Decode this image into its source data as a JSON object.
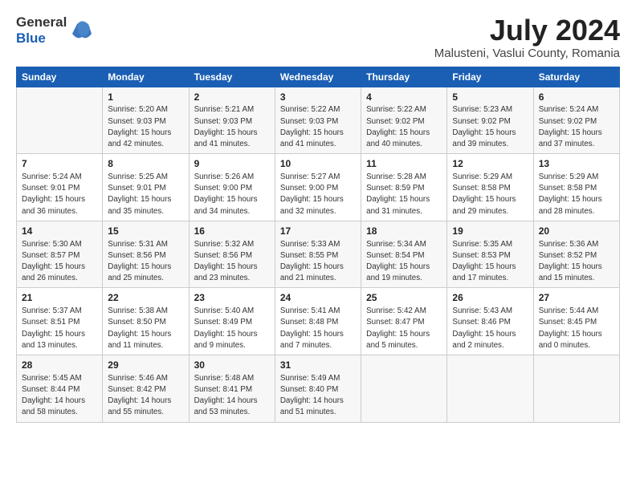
{
  "logo": {
    "line1": "General",
    "line2": "Blue"
  },
  "title": {
    "month_year": "July 2024",
    "location": "Malusteni, Vaslui County, Romania"
  },
  "calendar": {
    "headers": [
      "Sunday",
      "Monday",
      "Tuesday",
      "Wednesday",
      "Thursday",
      "Friday",
      "Saturday"
    ],
    "weeks": [
      [
        {
          "day": "",
          "info": ""
        },
        {
          "day": "1",
          "info": "Sunrise: 5:20 AM\nSunset: 9:03 PM\nDaylight: 15 hours\nand 42 minutes."
        },
        {
          "day": "2",
          "info": "Sunrise: 5:21 AM\nSunset: 9:03 PM\nDaylight: 15 hours\nand 41 minutes."
        },
        {
          "day": "3",
          "info": "Sunrise: 5:22 AM\nSunset: 9:03 PM\nDaylight: 15 hours\nand 41 minutes."
        },
        {
          "day": "4",
          "info": "Sunrise: 5:22 AM\nSunset: 9:02 PM\nDaylight: 15 hours\nand 40 minutes."
        },
        {
          "day": "5",
          "info": "Sunrise: 5:23 AM\nSunset: 9:02 PM\nDaylight: 15 hours\nand 39 minutes."
        },
        {
          "day": "6",
          "info": "Sunrise: 5:24 AM\nSunset: 9:02 PM\nDaylight: 15 hours\nand 37 minutes."
        }
      ],
      [
        {
          "day": "7",
          "info": "Sunrise: 5:24 AM\nSunset: 9:01 PM\nDaylight: 15 hours\nand 36 minutes."
        },
        {
          "day": "8",
          "info": "Sunrise: 5:25 AM\nSunset: 9:01 PM\nDaylight: 15 hours\nand 35 minutes."
        },
        {
          "day": "9",
          "info": "Sunrise: 5:26 AM\nSunset: 9:00 PM\nDaylight: 15 hours\nand 34 minutes."
        },
        {
          "day": "10",
          "info": "Sunrise: 5:27 AM\nSunset: 9:00 PM\nDaylight: 15 hours\nand 32 minutes."
        },
        {
          "day": "11",
          "info": "Sunrise: 5:28 AM\nSunset: 8:59 PM\nDaylight: 15 hours\nand 31 minutes."
        },
        {
          "day": "12",
          "info": "Sunrise: 5:29 AM\nSunset: 8:58 PM\nDaylight: 15 hours\nand 29 minutes."
        },
        {
          "day": "13",
          "info": "Sunrise: 5:29 AM\nSunset: 8:58 PM\nDaylight: 15 hours\nand 28 minutes."
        }
      ],
      [
        {
          "day": "14",
          "info": "Sunrise: 5:30 AM\nSunset: 8:57 PM\nDaylight: 15 hours\nand 26 minutes."
        },
        {
          "day": "15",
          "info": "Sunrise: 5:31 AM\nSunset: 8:56 PM\nDaylight: 15 hours\nand 25 minutes."
        },
        {
          "day": "16",
          "info": "Sunrise: 5:32 AM\nSunset: 8:56 PM\nDaylight: 15 hours\nand 23 minutes."
        },
        {
          "day": "17",
          "info": "Sunrise: 5:33 AM\nSunset: 8:55 PM\nDaylight: 15 hours\nand 21 minutes."
        },
        {
          "day": "18",
          "info": "Sunrise: 5:34 AM\nSunset: 8:54 PM\nDaylight: 15 hours\nand 19 minutes."
        },
        {
          "day": "19",
          "info": "Sunrise: 5:35 AM\nSunset: 8:53 PM\nDaylight: 15 hours\nand 17 minutes."
        },
        {
          "day": "20",
          "info": "Sunrise: 5:36 AM\nSunset: 8:52 PM\nDaylight: 15 hours\nand 15 minutes."
        }
      ],
      [
        {
          "day": "21",
          "info": "Sunrise: 5:37 AM\nSunset: 8:51 PM\nDaylight: 15 hours\nand 13 minutes."
        },
        {
          "day": "22",
          "info": "Sunrise: 5:38 AM\nSunset: 8:50 PM\nDaylight: 15 hours\nand 11 minutes."
        },
        {
          "day": "23",
          "info": "Sunrise: 5:40 AM\nSunset: 8:49 PM\nDaylight: 15 hours\nand 9 minutes."
        },
        {
          "day": "24",
          "info": "Sunrise: 5:41 AM\nSunset: 8:48 PM\nDaylight: 15 hours\nand 7 minutes."
        },
        {
          "day": "25",
          "info": "Sunrise: 5:42 AM\nSunset: 8:47 PM\nDaylight: 15 hours\nand 5 minutes."
        },
        {
          "day": "26",
          "info": "Sunrise: 5:43 AM\nSunset: 8:46 PM\nDaylight: 15 hours\nand 2 minutes."
        },
        {
          "day": "27",
          "info": "Sunrise: 5:44 AM\nSunset: 8:45 PM\nDaylight: 15 hours\nand 0 minutes."
        }
      ],
      [
        {
          "day": "28",
          "info": "Sunrise: 5:45 AM\nSunset: 8:44 PM\nDaylight: 14 hours\nand 58 minutes."
        },
        {
          "day": "29",
          "info": "Sunrise: 5:46 AM\nSunset: 8:42 PM\nDaylight: 14 hours\nand 55 minutes."
        },
        {
          "day": "30",
          "info": "Sunrise: 5:48 AM\nSunset: 8:41 PM\nDaylight: 14 hours\nand 53 minutes."
        },
        {
          "day": "31",
          "info": "Sunrise: 5:49 AM\nSunset: 8:40 PM\nDaylight: 14 hours\nand 51 minutes."
        },
        {
          "day": "",
          "info": ""
        },
        {
          "day": "",
          "info": ""
        },
        {
          "day": "",
          "info": ""
        }
      ]
    ]
  }
}
